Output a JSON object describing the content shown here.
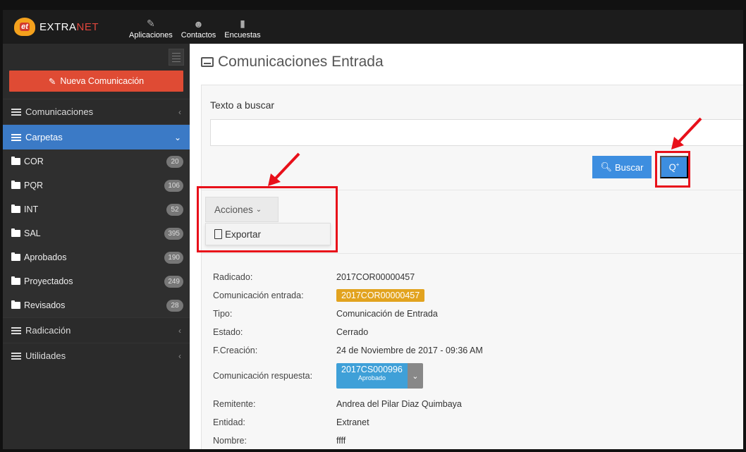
{
  "brand": {
    "logo_text": "et",
    "name_a": "EXTRA",
    "name_b": "NET"
  },
  "topnav": [
    {
      "label": "Aplicaciones",
      "icon": "pencil-icon"
    },
    {
      "label": "Contactos",
      "icon": "users-icon"
    },
    {
      "label": "Encuestas",
      "icon": "file-icon"
    }
  ],
  "sidebar": {
    "new_button": "Nueva Comunicación",
    "menu": [
      {
        "label": "Comunicaciones"
      },
      {
        "label": "Carpetas"
      }
    ],
    "folders": [
      {
        "label": "COR",
        "count": "20"
      },
      {
        "label": "PQR",
        "count": "106"
      },
      {
        "label": "INT",
        "count": "52"
      },
      {
        "label": "SAL",
        "count": "395"
      },
      {
        "label": "Aprobados",
        "count": "190"
      },
      {
        "label": "Proyectados",
        "count": "249"
      },
      {
        "label": "Revisados",
        "count": "28"
      }
    ],
    "bottom_menu": [
      {
        "label": "Radicación"
      },
      {
        "label": "Utilidades"
      }
    ]
  },
  "main": {
    "title": "Comunicaciones Entrada",
    "search_label": "Texto a buscar",
    "search_value": "",
    "buscar_label": "Buscar",
    "acciones_label": "Acciones",
    "export_label": "Exportar"
  },
  "details": {
    "radicado_label": "Radicado:",
    "radicado_value": "2017COR00000457",
    "entrada_label": "Comunicación entrada:",
    "entrada_value": "2017COR00000457",
    "tipo_label": "Tipo:",
    "tipo_value": "Comunicación de Entrada",
    "estado_label": "Estado:",
    "estado_value": "Cerrado",
    "fecha_label": "F.Creación:",
    "fecha_value": "24 de Noviembre de 2017 - 09:36 AM",
    "respuesta_label": "Comunicación respuesta:",
    "respuesta_value": "2017CS000996",
    "respuesta_status": "Aprobado",
    "remitente_label": "Remitente:",
    "remitente_value": "Andrea del Pilar Diaz Quimbaya",
    "entidad_label": "Entidad:",
    "entidad_value": "Extranet",
    "nombre_label": "Nombre:",
    "nombre_value": "ffff"
  },
  "colors": {
    "sidebar_active": "#3b7ac6",
    "new_button": "#df4b34",
    "tag_orange": "#e2a31f",
    "tag_blue": "#3fa0d8",
    "highlight": "#e8101a"
  }
}
